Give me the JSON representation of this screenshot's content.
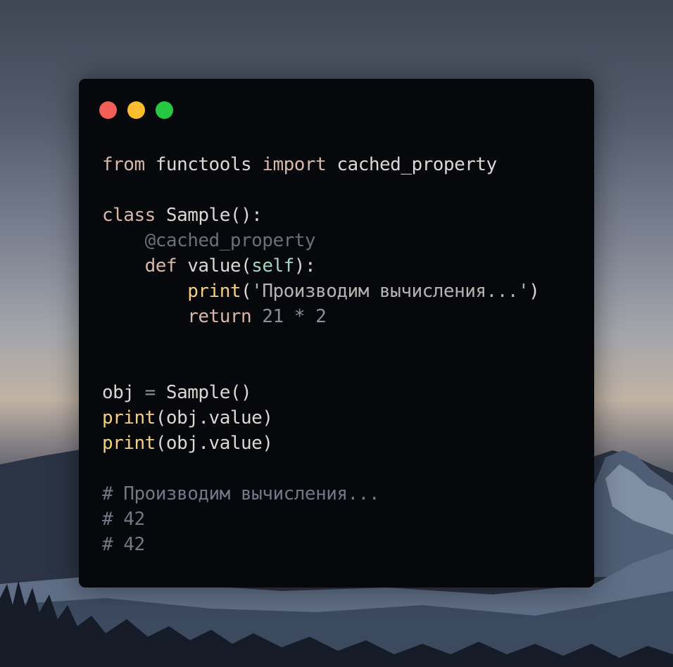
{
  "window": {
    "traffic_lights": [
      {
        "name": "close",
        "color": "#f35e57"
      },
      {
        "name": "minimize",
        "color": "#fbbd2e"
      },
      {
        "name": "maximize",
        "color": "#27c841"
      }
    ]
  },
  "code": {
    "lines": [
      [
        {
          "t": "from",
          "k": "keyword"
        },
        {
          "t": " functools ",
          "k": "plain"
        },
        {
          "t": "import",
          "k": "keyword"
        },
        {
          "t": " cached_property",
          "k": "plain"
        }
      ],
      [],
      [
        {
          "t": "class",
          "k": "keyword"
        },
        {
          "t": " Sample():",
          "k": "plain"
        }
      ],
      [
        {
          "t": "    @cached_property",
          "k": "decorator"
        }
      ],
      [
        {
          "t": "    ",
          "k": "plain"
        },
        {
          "t": "def",
          "k": "keyword"
        },
        {
          "t": " value(",
          "k": "plain"
        },
        {
          "t": "self",
          "k": "self"
        },
        {
          "t": "):",
          "k": "plain"
        }
      ],
      [
        {
          "t": "        ",
          "k": "plain"
        },
        {
          "t": "print",
          "k": "builtin"
        },
        {
          "t": "(",
          "k": "plain"
        },
        {
          "t": "'Производим вычисления...'",
          "k": "string"
        },
        {
          "t": ")",
          "k": "plain"
        }
      ],
      [
        {
          "t": "        ",
          "k": "plain"
        },
        {
          "t": "return",
          "k": "keyword"
        },
        {
          "t": " 21 ",
          "k": "number"
        },
        {
          "t": "*",
          "k": "op"
        },
        {
          "t": " 2",
          "k": "number"
        }
      ],
      [],
      [],
      [
        {
          "t": "obj ",
          "k": "plain"
        },
        {
          "t": "=",
          "k": "op"
        },
        {
          "t": " Sample()",
          "k": "plain"
        }
      ],
      [
        {
          "t": "print",
          "k": "builtin"
        },
        {
          "t": "(obj.value)",
          "k": "plain"
        }
      ],
      [
        {
          "t": "print",
          "k": "builtin"
        },
        {
          "t": "(obj.value)",
          "k": "plain"
        }
      ],
      [],
      [
        {
          "t": "# Производим вычисления...",
          "k": "comment"
        }
      ],
      [
        {
          "t": "# 42",
          "k": "comment"
        }
      ],
      [
        {
          "t": "# 42",
          "k": "comment"
        }
      ]
    ]
  }
}
